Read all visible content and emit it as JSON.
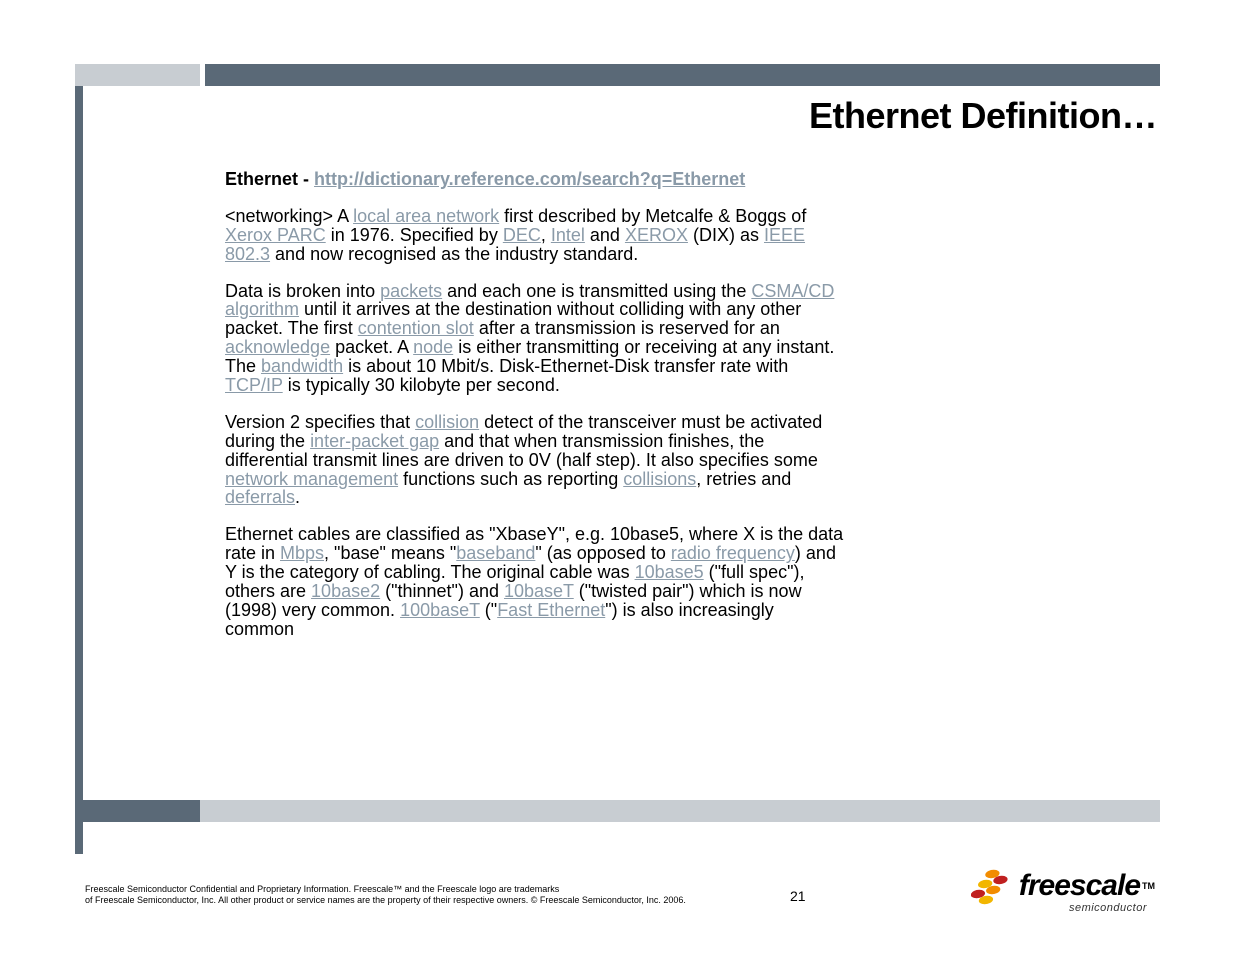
{
  "title": "Ethernet Definition…",
  "heading_prefix": "Ethernet - ",
  "heading_url": "http://dictionary.reference.com/search?q=Ethernet",
  "p1": {
    "t0": "<networking> A ",
    "l0": "local area network",
    "t1": " first described by Metcalfe & Boggs of ",
    "l1": "Xerox PARC",
    "t2": " in 1976. Specified by ",
    "l2": "DEC",
    "t3": ", ",
    "l3": "Intel",
    "t4": " and ",
    "l4": "XEROX",
    "t5": " (DIX) as ",
    "l5": "IEEE 802.3",
    "t6": " and now recognised as the industry standard."
  },
  "p2": {
    "t0": "Data is broken into ",
    "l0": "packets",
    "t1": " and each one is transmitted using the ",
    "l1": "CSMA/CD",
    "t2": " ",
    "l2": "algorithm",
    "t3": " until it arrives at the destination without colliding with any other packet. The first ",
    "l3": "contention slot",
    "t4": " after a transmission is reserved for an ",
    "l4": "acknowledge",
    "t5": " packet. A ",
    "l5": "node",
    "t6": " is either transmitting or receiving at any instant. The ",
    "l6": "bandwidth",
    "t7": " is about 10 Mbit/s. Disk-Ethernet-Disk transfer rate with ",
    "l7": "TCP/IP",
    "t8": " is typically 30 kilobyte per second."
  },
  "p3": {
    "t0": "Version 2 specifies that ",
    "l0": "collision",
    "t1": " detect of the transceiver must be activated during the ",
    "l1": "inter-packet gap",
    "t2": " and that when transmission finishes, the differential transmit lines are driven to 0V (half step). It also specifies some ",
    "l2": "network management",
    "t3": " functions such as reporting ",
    "l3": "collisions",
    "t4": ", retries and ",
    "l4": "deferrals",
    "t5": "."
  },
  "p4": {
    "t0": "Ethernet cables are classified as \"XbaseY\", e.g. 10base5, where X is the data rate in ",
    "l0": "Mbps",
    "t1": ", \"base\" means \"",
    "l1": "baseband",
    "t2": "\" (as opposed to ",
    "l2": "radio frequency",
    "t3": ") and Y is the category of cabling. The original cable was ",
    "l3": "10base5",
    "t4": " (\"full spec\"), others are ",
    "l4": "10base2",
    "t5": " (\"thinnet\") and ",
    "l5": "10baseT",
    "t6": " (\"twisted pair\") which is now (1998) very common. ",
    "l6": "100baseT",
    "t7": " (\"",
    "l7": "Fast Ethernet",
    "t8": "\") is also increasingly common"
  },
  "footnote_line1": "Freescale Semiconductor Confidential and Proprietary Information. Freescale™ and the Freescale logo are trademarks",
  "footnote_line2": "of Freescale Semiconductor, Inc. All other product or service names are the property of their respective owners. © Freescale Semiconductor, Inc. 2006.",
  "page_number": "21",
  "logo_text": "freescale",
  "logo_tm": "TM",
  "logo_sub": "semiconductor"
}
